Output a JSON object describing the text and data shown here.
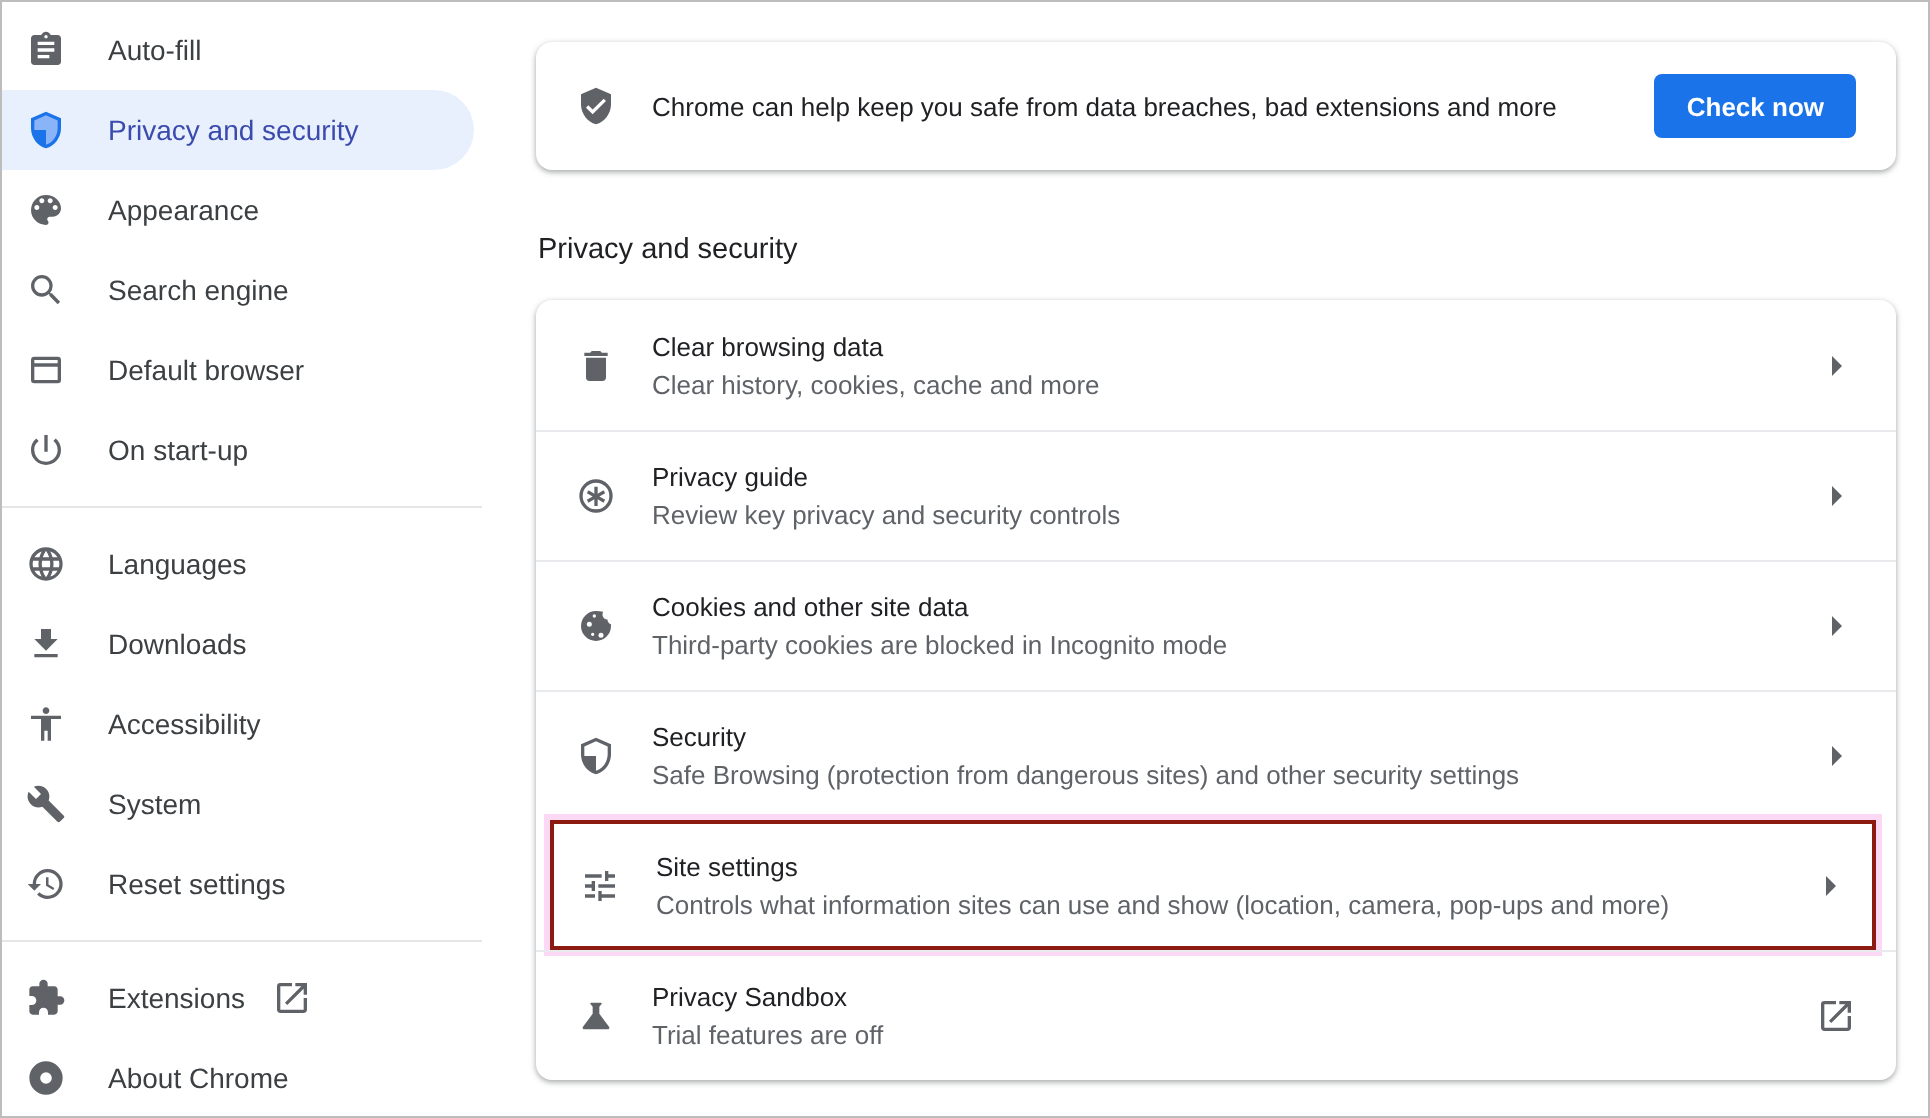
{
  "sidebar": {
    "groups": [
      {
        "items": [
          {
            "label": "Auto-fill",
            "selected": false,
            "kind": "page"
          },
          {
            "label": "Privacy and security",
            "selected": true,
            "kind": "page"
          },
          {
            "label": "Appearance",
            "selected": false,
            "kind": "page"
          },
          {
            "label": "Search engine",
            "selected": false,
            "kind": "page"
          },
          {
            "label": "Default browser",
            "selected": false,
            "kind": "page"
          },
          {
            "label": "On start-up",
            "selected": false,
            "kind": "page"
          }
        ]
      },
      {
        "items": [
          {
            "label": "Languages",
            "selected": false,
            "kind": "page"
          },
          {
            "label": "Downloads",
            "selected": false,
            "kind": "page"
          },
          {
            "label": "Accessibility",
            "selected": false,
            "kind": "page"
          },
          {
            "label": "System",
            "selected": false,
            "kind": "page"
          },
          {
            "label": "Reset settings",
            "selected": false,
            "kind": "page"
          }
        ]
      },
      {
        "items": [
          {
            "label": "Extensions",
            "selected": false,
            "kind": "external"
          },
          {
            "label": "About Chrome",
            "selected": false,
            "kind": "page"
          }
        ]
      }
    ]
  },
  "safety_check": {
    "text": "Chrome can help keep you safe from data breaches, bad extensions and more",
    "button": "Check now"
  },
  "section": {
    "heading": "Privacy and security",
    "rows": [
      {
        "title": "Clear browsing data",
        "subtitle": "Clear history, cookies, cache and more",
        "kind": "submenu",
        "highlighted": false
      },
      {
        "title": "Privacy guide",
        "subtitle": "Review key privacy and security controls",
        "kind": "submenu",
        "highlighted": false
      },
      {
        "title": "Cookies and other site data",
        "subtitle": "Third-party cookies are blocked in Incognito mode",
        "kind": "submenu",
        "highlighted": false
      },
      {
        "title": "Security",
        "subtitle": "Safe Browsing (protection from dangerous sites) and other security settings",
        "kind": "submenu",
        "highlighted": false
      },
      {
        "title": "Site settings",
        "subtitle": "Controls what information sites can use and show (location, camera, pop-ups and more)",
        "kind": "submenu",
        "highlighted": true
      },
      {
        "title": "Privacy Sandbox",
        "subtitle": "Trial features are off",
        "kind": "external",
        "highlighted": false
      }
    ]
  }
}
